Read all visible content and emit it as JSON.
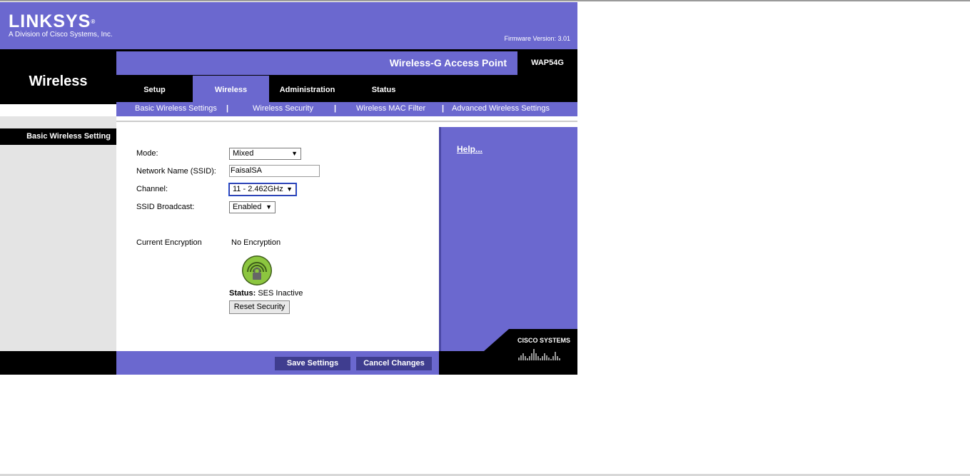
{
  "brand": {
    "logo_text": "LINKSYS",
    "registered": "®",
    "tagline": "A Division of Cisco Systems, Inc.",
    "firmware": "Firmware Version: 3.01"
  },
  "section_title": "Wireless",
  "product": {
    "name": "Wireless-G Access Point",
    "model": "WAP54G"
  },
  "tabs": [
    {
      "label": "Setup"
    },
    {
      "label": "Wireless",
      "active": true
    },
    {
      "label": "Administration"
    },
    {
      "label": "Status"
    }
  ],
  "subnav": {
    "items": [
      "Basic Wireless Settings",
      "Wireless Security",
      "Wireless MAC Filter",
      "Advanced Wireless Settings"
    ],
    "separator": "|"
  },
  "sidebar_label": "Basic Wireless Setting",
  "form": {
    "mode": {
      "label": "Mode:",
      "value": "Mixed"
    },
    "ssid": {
      "label": "Network Name (SSID):",
      "value": "FaisalSA"
    },
    "channel": {
      "label": "Channel:",
      "value": "11 - 2.462GHz"
    },
    "broadcast": {
      "label": "SSID Broadcast:",
      "value": "Enabled"
    }
  },
  "encryption": {
    "label": "Current Encryption",
    "value": "No Encryption",
    "status_label": "Status:",
    "status_value": "SES Inactive",
    "reset_button": "Reset Security"
  },
  "help": {
    "label": "Help..."
  },
  "actions": {
    "save": "Save Settings",
    "cancel": "Cancel Changes"
  },
  "cisco": {
    "text": "CISCO SYSTEMS"
  },
  "colors": {
    "brand_purple": "#6b68cf",
    "button_navy": "#3f3d8f",
    "black": "#000000"
  },
  "icons": {
    "dropdown": "▼"
  }
}
